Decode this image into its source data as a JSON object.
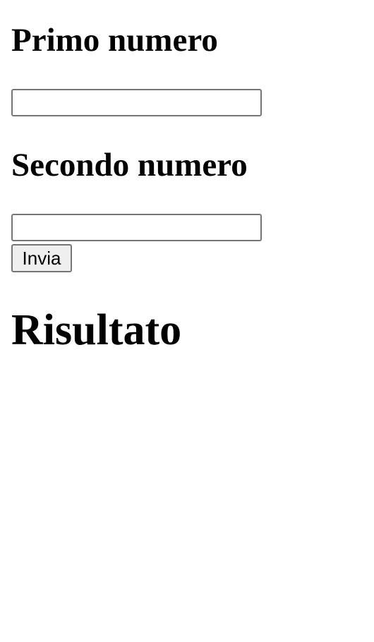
{
  "form": {
    "first_number_label": "Primo numero",
    "first_number_value": "",
    "second_number_label": "Secondo numero",
    "second_number_value": "",
    "submit_label": "Invia"
  },
  "result": {
    "heading": "Risultato"
  }
}
